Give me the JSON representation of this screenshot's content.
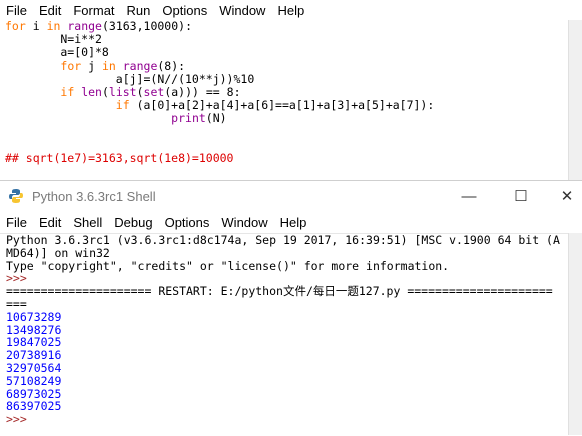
{
  "editor_menu": [
    "File",
    "Edit",
    "Format",
    "Run",
    "Options",
    "Window",
    "Help"
  ],
  "code": {
    "l1a": "for",
    "l1b": " i ",
    "l1c": "in",
    "l1d": " ",
    "l1e": "range",
    "l1f": "(3163,10000):",
    "l2": "        N=i**2",
    "l3": "        a=[0]*8",
    "l4a": "        ",
    "l4b": "for",
    "l4c": " j ",
    "l4d": "in",
    "l4e": " ",
    "l4f": "range",
    "l4g": "(8):",
    "l5": "                a[j]=(N//(10**j))%10",
    "l6a": "        ",
    "l6b": "if",
    "l6c": " ",
    "l6d": "len",
    "l6e": "(",
    "l6f": "list",
    "l6g": "(",
    "l6h": "set",
    "l6i": "(a))) == 8:",
    "l7a": "                ",
    "l7b": "if",
    "l7c": " (a[0]+a[2]+a[4]+a[6]==a[1]+a[3]+a[5]+a[7]):",
    "l8a": "                        ",
    "l8b": "print",
    "l8c": "(N)",
    "comment": "## sqrt(1e7)=3163,sqrt(1e8)=10000"
  },
  "shell": {
    "title": "Python 3.6.3rc1 Shell",
    "menu": [
      "File",
      "Edit",
      "Shell",
      "Debug",
      "Options",
      "Window",
      "Help"
    ],
    "minimize": "—",
    "maximize": "☐",
    "close": "✕",
    "banner": [
      "Python 3.6.3rc1 (v3.6.3rc1:d8c174a, Sep 19 2017, 16:39:51) [MSC v.1900 64 bit (A",
      "MD64)] on win32",
      "Type \"copyright\", \"credits\" or \"license()\" for more information."
    ],
    "prompt": ">>>",
    "restart1": "===================== RESTART: E:/python文件/每日一题127.py =====================",
    "restart2": "===",
    "outputs": [
      "10673289",
      "13498276",
      "19847025",
      "20738916",
      "32970564",
      "57108249",
      "68973025",
      "86397025"
    ]
  }
}
